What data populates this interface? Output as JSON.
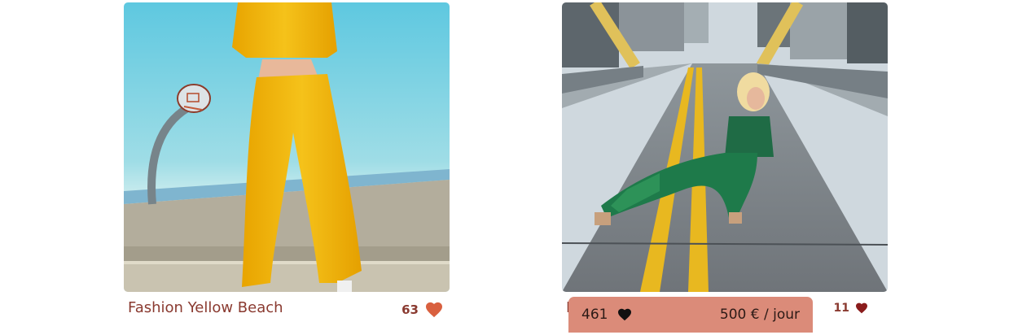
{
  "cards": [
    {
      "title": "Fashion Yellow Beach",
      "likes": "63",
      "image": "yellow tracksuit by basketball hoop"
    },
    {
      "title": "F",
      "likes": "11",
      "image": "woman in green print outfit on road",
      "hover": {
        "likes": "461",
        "price": "500 € / jour"
      }
    }
  ],
  "colors": {
    "title": "#8a3a30",
    "heart_filled": "#d9603f",
    "heart_dark": "#8a1c1c",
    "hover_bar": "#db8b79"
  }
}
